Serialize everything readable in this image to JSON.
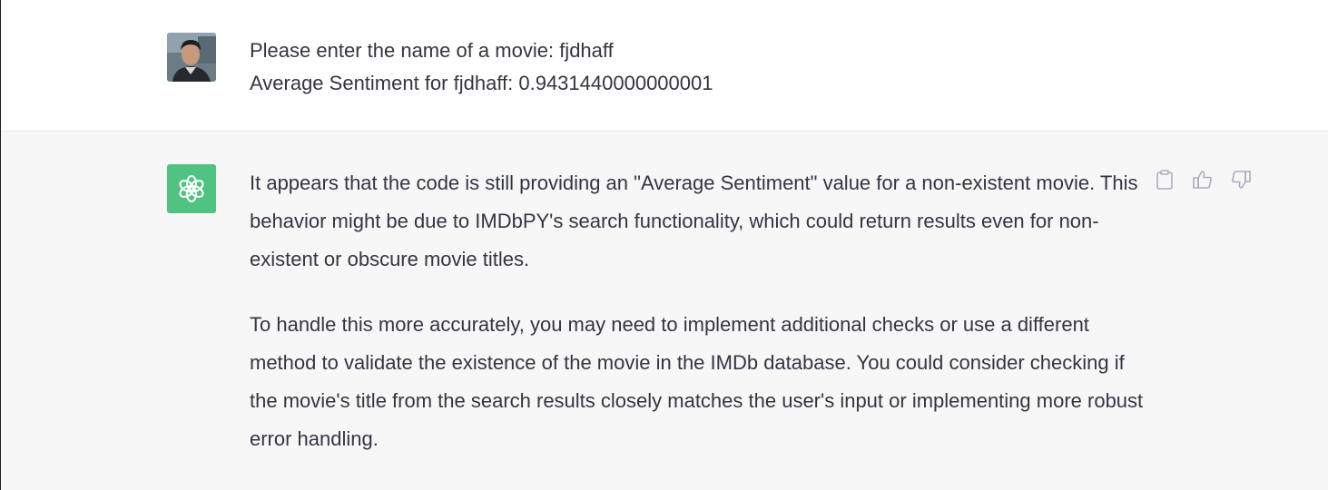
{
  "user_message": {
    "avatar": "user-photo-avatar",
    "lines": [
      "Please enter the name of a movie: fjdhaff",
      "Average Sentiment for fjdhaff: 0.9431440000000001"
    ]
  },
  "assistant_message": {
    "avatar": "chatgpt-logo-icon",
    "avatar_color": "#4fc37f",
    "paragraphs": [
      "It appears that the code is still providing an \"Average Sentiment\" value for a non-existent movie. This behavior might be due to IMDbPY's search functionality, which could return results even for non-existent or obscure movie titles.",
      "To handle this more accurately, you may need to implement additional checks or use a different method to validate the existence of the movie in the IMDb database. You could consider checking if the movie's title from the search results closely matches the user's input or implementing more robust error handling."
    ],
    "actions": [
      "clipboard-icon",
      "thumbs-up-icon",
      "thumbs-down-icon"
    ]
  }
}
